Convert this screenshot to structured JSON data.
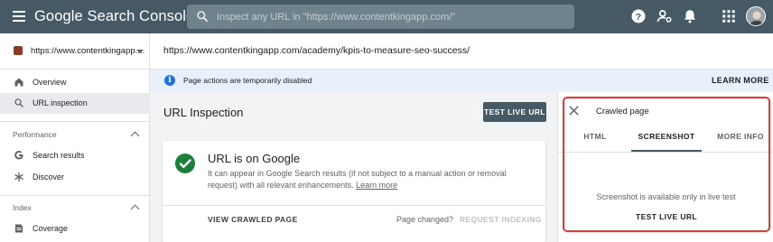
{
  "app": {
    "title": "Google Search Console"
  },
  "search": {
    "placeholder": "Inspect any URL in \"https://www.contentkingapp.com/\""
  },
  "header_icons": [
    "help-icon",
    "account-settings-icon",
    "notifications-icon",
    "apps-grid-icon",
    "avatar"
  ],
  "property": {
    "label": "https://www.contentkingapp...."
  },
  "inspected_url": "https://www.contentkingapp.com/academy/kpis-to-measure-seo-success/",
  "banner": {
    "text": "Page actions are temporarily disabled",
    "action": "LEARN MORE"
  },
  "sidebar": {
    "items": [
      {
        "label": "Overview",
        "icon": "home-icon"
      },
      {
        "label": "URL inspection",
        "icon": "search-icon"
      }
    ],
    "performance": {
      "heading": "Performance",
      "items": [
        {
          "label": "Search results",
          "icon": "google-g-icon"
        },
        {
          "label": "Discover",
          "icon": "asterisk-icon"
        }
      ]
    },
    "index": {
      "heading": "Index",
      "items": [
        {
          "label": "Coverage",
          "icon": "coverage-icon"
        }
      ]
    }
  },
  "main": {
    "heading": "URL Inspection",
    "test_live_button": "TEST LIVE URL",
    "card": {
      "title": "URL is on Google",
      "description": "It can appear in Google Search results (if not subject to a manual action or removal request) with all relevant enhancements.",
      "link": "Learn more",
      "view_crawled": "VIEW CRAWLED PAGE",
      "page_changed": "Page changed?",
      "request_indexing": "REQUEST INDEXING"
    }
  },
  "panel": {
    "title": "Crawled page",
    "tabs": [
      {
        "label": "HTML",
        "active": false
      },
      {
        "label": "SCREENSHOT",
        "active": true
      },
      {
        "label": "MORE INFO",
        "active": false
      }
    ],
    "message": "Screenshot is available only in live test",
    "button": "TEST LIVE URL"
  },
  "colors": {
    "topbar": "#455a64",
    "success": "#188038",
    "highlight": "#e53935",
    "banner": "#e8f1fb"
  }
}
